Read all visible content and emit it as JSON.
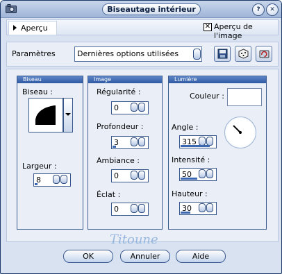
{
  "window": {
    "title": "Biseautage intérieur"
  },
  "preview": {
    "label": "Aperçu",
    "checkbox_label": "Aperçu de l'image",
    "checkbox_checked": true
  },
  "params": {
    "label": "Paramètres",
    "preset_value": "Dernières options utilisées"
  },
  "bevel": {
    "header": "Biseau",
    "shape_label": "Biseau :",
    "width_label": "Largeur :",
    "width_value": "8"
  },
  "image": {
    "header": "Image",
    "smoothness_label": "Régularité :",
    "smoothness_value": "0",
    "depth_label": "Profondeur :",
    "depth_value": "3",
    "ambience_label": "Ambiance :",
    "ambience_value": "0",
    "shininess_label": "Éclat :",
    "shininess_value": "0"
  },
  "light": {
    "header": "Lumière",
    "color_label": "Couleur :",
    "color_value": "#ffffff",
    "angle_label": "Angle :",
    "angle_value": "315",
    "intensity_label": "Intensité :",
    "intensity_value": "50",
    "height_label": "Hauteur :",
    "height_value": "30"
  },
  "watermark": "Titoune",
  "buttons": {
    "ok": "OK",
    "cancel": "Annuler",
    "help": "Aide"
  },
  "levels": {
    "width": 0.08,
    "depth": 0.1,
    "angle": 0.87,
    "intensity": 0.5,
    "height": 0.3
  }
}
